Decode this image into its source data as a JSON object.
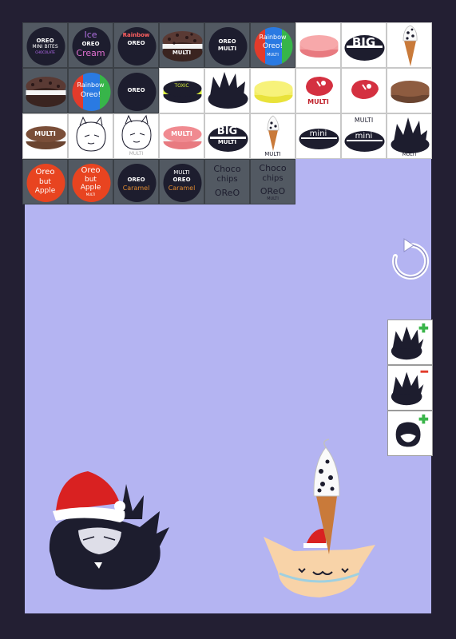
{
  "palette": {
    "background": "#231f33",
    "stage": "#b4b4f2",
    "dark_tile": "#525962",
    "light_tile": "#ffffff",
    "cookie": "#1d1d2e",
    "refresh_icon": "#ffffff"
  },
  "tiles": {
    "r1": [
      {
        "l1": "OREO",
        "l2": "MINI BITES",
        "l3": "CHOCOLATE"
      },
      {
        "l1": "Ice",
        "l2": "OREO",
        "l3": "Cream"
      },
      {
        "l1": "Rainbow",
        "l2": "OREO"
      },
      {
        "l1": "MULTI"
      },
      {
        "l1": "OREO",
        "l2": "MULTI"
      },
      {
        "l1": "Rainbow",
        "l2": "Oreo!",
        "l3": "MULTI"
      },
      {},
      {
        "l1": "BIG"
      },
      {}
    ],
    "r2": [
      {},
      {
        "l1": "Rainbow",
        "l2": "Oreo!"
      },
      {
        "l1": "OREO"
      },
      {
        "l1": "TOXIC"
      },
      {},
      {},
      {
        "l1": "MULTI"
      },
      {},
      {}
    ],
    "r3": [
      {
        "l1": "MULTI"
      },
      {},
      {
        "l1": "MULTI"
      },
      {
        "l1": "MULTI"
      },
      {
        "l1": "BIG",
        "l2": "MULTI"
      },
      {
        "l1": "MULTI"
      },
      {
        "l1": "mini"
      },
      {
        "l1": "MULTI",
        "l2": "mini"
      },
      {
        "l1": "MULTI"
      }
    ],
    "r4": [
      {
        "l1": "Oreo",
        "l2": "but",
        "l3": "Apple"
      },
      {
        "l1": "Oreo",
        "l2": "but",
        "l3": "Apple",
        "l4": "MULTI"
      },
      {
        "l1": "OREO",
        "l2": "Caramel"
      },
      {
        "l1": "MULTI",
        "l2": "OREO",
        "l3": "Caramel"
      },
      {
        "l1": "Choco",
        "l2": "chips",
        "l3": "OReO"
      },
      {
        "l1": "Choco",
        "l2": "chips",
        "l3": "OReO",
        "l4": "MULTI"
      }
    ]
  },
  "side_panel": {
    "items": [
      {
        "icon": "plus-icon"
      },
      {
        "icon": "minus-icon"
      },
      {
        "icon": "plus-icon"
      }
    ]
  },
  "icons": {
    "refresh": "refresh-icon"
  }
}
